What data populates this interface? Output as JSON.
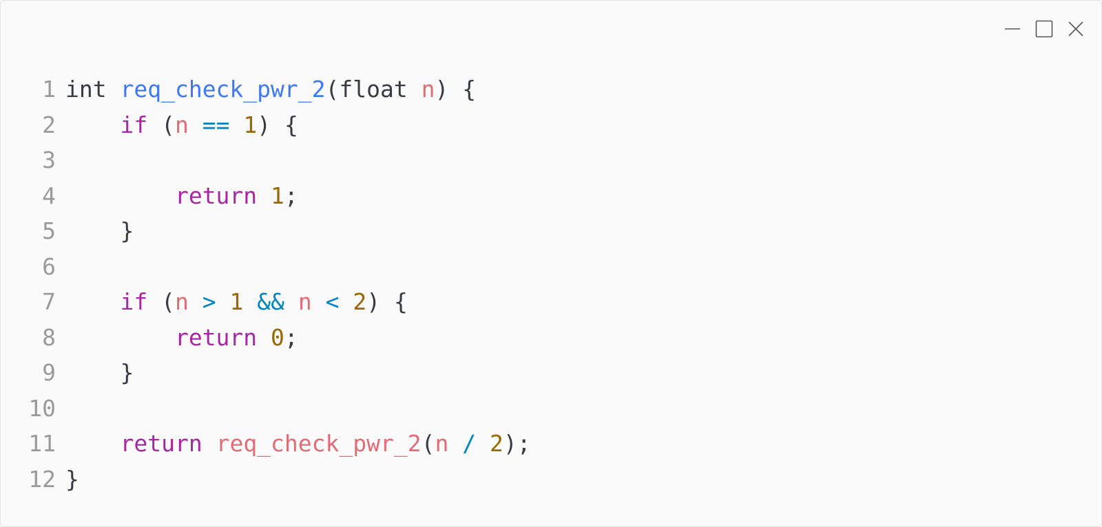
{
  "window_controls": {
    "minimize_icon": "minimize-icon",
    "maximize_icon": "maximize-icon",
    "close_icon": "close-icon"
  },
  "code": {
    "language": "c",
    "lines": [
      {
        "num": "1",
        "tokens": [
          {
            "t": "int ",
            "c": "plain"
          },
          {
            "t": "req_check_pwr_2",
            "c": "fn"
          },
          {
            "t": "(float ",
            "c": "plain"
          },
          {
            "t": "n",
            "c": "var"
          },
          {
            "t": ") {",
            "c": "plain"
          }
        ]
      },
      {
        "num": "2",
        "tokens": [
          {
            "t": "    ",
            "c": "plain"
          },
          {
            "t": "if",
            "c": "kw"
          },
          {
            "t": " (",
            "c": "plain"
          },
          {
            "t": "n",
            "c": "var"
          },
          {
            "t": " ",
            "c": "plain"
          },
          {
            "t": "==",
            "c": "op"
          },
          {
            "t": " ",
            "c": "plain"
          },
          {
            "t": "1",
            "c": "num"
          },
          {
            "t": ") {",
            "c": "plain"
          }
        ]
      },
      {
        "num": "3",
        "tokens": []
      },
      {
        "num": "4",
        "tokens": [
          {
            "t": "        ",
            "c": "plain"
          },
          {
            "t": "return",
            "c": "kw"
          },
          {
            "t": " ",
            "c": "plain"
          },
          {
            "t": "1",
            "c": "num"
          },
          {
            "t": ";",
            "c": "plain"
          }
        ]
      },
      {
        "num": "5",
        "tokens": [
          {
            "t": "    }",
            "c": "plain"
          }
        ]
      },
      {
        "num": "6",
        "tokens": []
      },
      {
        "num": "7",
        "tokens": [
          {
            "t": "    ",
            "c": "plain"
          },
          {
            "t": "if",
            "c": "kw"
          },
          {
            "t": " (",
            "c": "plain"
          },
          {
            "t": "n",
            "c": "var"
          },
          {
            "t": " ",
            "c": "plain"
          },
          {
            "t": ">",
            "c": "op"
          },
          {
            "t": " ",
            "c": "plain"
          },
          {
            "t": "1",
            "c": "num"
          },
          {
            "t": " ",
            "c": "plain"
          },
          {
            "t": "&&",
            "c": "op"
          },
          {
            "t": " ",
            "c": "plain"
          },
          {
            "t": "n",
            "c": "var"
          },
          {
            "t": " ",
            "c": "plain"
          },
          {
            "t": "<",
            "c": "op"
          },
          {
            "t": " ",
            "c": "plain"
          },
          {
            "t": "2",
            "c": "num"
          },
          {
            "t": ") {",
            "c": "plain"
          }
        ]
      },
      {
        "num": "8",
        "tokens": [
          {
            "t": "        ",
            "c": "plain"
          },
          {
            "t": "return",
            "c": "kw"
          },
          {
            "t": " ",
            "c": "plain"
          },
          {
            "t": "0",
            "c": "num"
          },
          {
            "t": ";",
            "c": "plain"
          }
        ]
      },
      {
        "num": "9",
        "tokens": [
          {
            "t": "    }",
            "c": "plain"
          }
        ]
      },
      {
        "num": "10",
        "tokens": []
      },
      {
        "num": "11",
        "tokens": [
          {
            "t": "    ",
            "c": "plain"
          },
          {
            "t": "return",
            "c": "kw"
          },
          {
            "t": " ",
            "c": "plain"
          },
          {
            "t": "req_check_pwr_2",
            "c": "call"
          },
          {
            "t": "(",
            "c": "plain"
          },
          {
            "t": "n",
            "c": "var"
          },
          {
            "t": " ",
            "c": "plain"
          },
          {
            "t": "/",
            "c": "op"
          },
          {
            "t": " ",
            "c": "plain"
          },
          {
            "t": "2",
            "c": "num"
          },
          {
            "t": ");",
            "c": "plain"
          }
        ]
      },
      {
        "num": "12",
        "tokens": [
          {
            "t": "}",
            "c": "plain"
          }
        ]
      }
    ]
  },
  "colors": {
    "background": "#fafafa",
    "plain": "#383a42",
    "keyword": "#a626a4",
    "function": "#4078f2",
    "variable": "#e06c75",
    "number": "#986801",
    "operator": "#0184bc",
    "line_number": "#9a9a9a"
  }
}
